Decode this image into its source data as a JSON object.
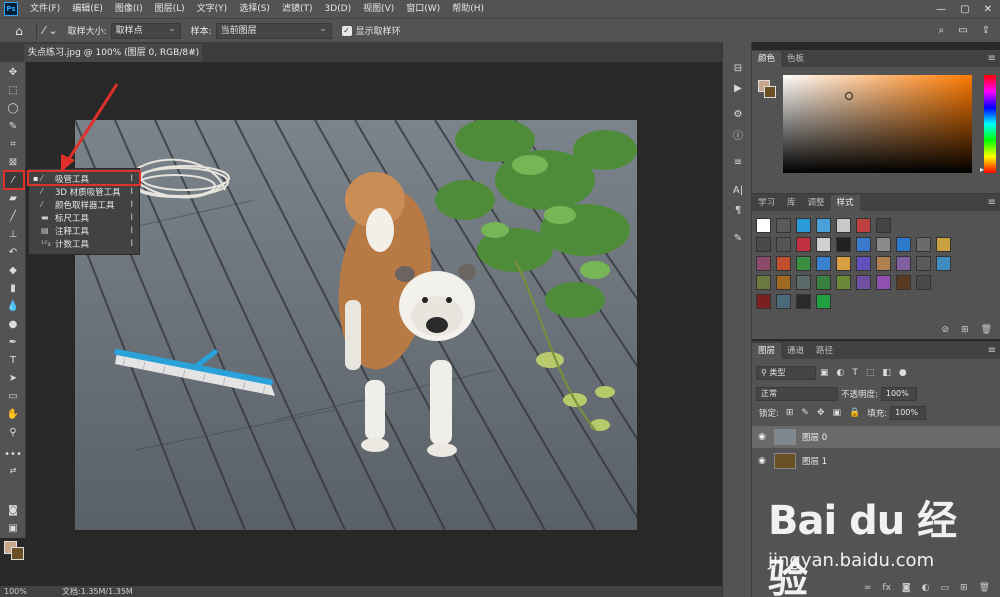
{
  "menubar": {
    "logo": "Ps",
    "items": [
      "文件(F)",
      "编辑(E)",
      "图像(I)",
      "图层(L)",
      "文字(Y)",
      "选择(S)",
      "滤镜(T)",
      "3D(D)",
      "视图(V)",
      "窗口(W)",
      "帮助(H)"
    ],
    "window_controls": [
      "—",
      "▢",
      "✕"
    ]
  },
  "optionsbar": {
    "sample_size_label": "取样大小:",
    "sample_size_value": "取样点",
    "sample_label": "样本:",
    "sample_value": "当前图层",
    "show_ring_label": "显示取样环"
  },
  "document": {
    "tab_title": "失点练习.jpg @ 100% (图层 0, RGB/8#) *",
    "close": "×"
  },
  "flyout": {
    "items": [
      {
        "label": "吸管工具",
        "key": "I",
        "current": true
      },
      {
        "label": "3D 材质吸管工具",
        "key": "I",
        "current": false
      },
      {
        "label": "颜色取样器工具",
        "key": "I",
        "current": false
      },
      {
        "label": "标尺工具",
        "key": "I",
        "current": false
      },
      {
        "label": "注释工具",
        "key": "I",
        "current": false
      },
      {
        "label": "计数工具",
        "key": "I",
        "current": false
      }
    ]
  },
  "statusbar": {
    "zoom": "100%",
    "doc_size": "文档:1.35M/1.35M"
  },
  "color_panel": {
    "tabs": [
      "颜色",
      "色板"
    ],
    "foreground": "#c9a68a",
    "background": "#6b4f24"
  },
  "styles_panel": {
    "tabs": [
      "学习",
      "库",
      "调整",
      "样式"
    ]
  },
  "layers_panel": {
    "tabs": [
      "图层",
      "通道",
      "路径"
    ],
    "filter_kind": "类型",
    "blend_mode": "正常",
    "opacity_label": "不透明度:",
    "opacity_value": "100%",
    "lock_label": "锁定:",
    "fill_label": "填充:",
    "fill_value": "100%",
    "layers": [
      {
        "name": "图层 0",
        "selected": true
      },
      {
        "name": "图层 1",
        "selected": false
      }
    ]
  },
  "watermark": {
    "brand": "Bai du 经验",
    "url": "jingyan.baidu.com"
  }
}
